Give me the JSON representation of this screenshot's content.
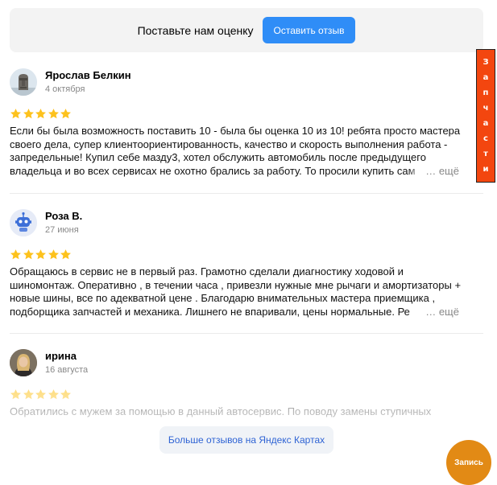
{
  "rating_prompt": {
    "text": "Поставьте нам оценку",
    "button": "Оставить отзыв"
  },
  "colors": {
    "star": "#fdc21d",
    "accent": "#2f8df7",
    "side_tab": "#f3460f",
    "record": "#e28a15"
  },
  "reviews": [
    {
      "author": "Ярослав Белкин",
      "date": "4 октября",
      "rating": 5,
      "avatar_icon": "moai-statue-icon",
      "lines": [
        "Если бы была возможность поставить 10 - была бы оценка 10 из 10! ребята просто мастера",
        "своего дела, супер клиентоориентированность, качество и скорость выполнения работа -",
        "запредельные! Купил себе мазду3, хотел обслужить автомобиль после предыдущего",
        "владельца и во всех сервисах не охотно брались за работу. То просили купить сам"
      ],
      "more": "… ещё"
    },
    {
      "author": "Роза В.",
      "date": "27 июня",
      "rating": 5,
      "avatar_icon": "robot-avatar-icon",
      "lines": [
        "Обращаюсь в сервис не в первый раз. Грамотно сделали диагностику ходовой и",
        "шиномонтаж. Оперативно , в течении часа , привезли нужные мне рычаги и амортизаторы +",
        "новые шины, все по адекватной цене . Благодарю внимательных мастера приемщика ,",
        "подборщика запчастей и механика. Лишнего не впаривали, цены нормальные. Ре"
      ],
      "more": "… ещё"
    },
    {
      "author": "ирина",
      "date": "16 августа",
      "rating": 5,
      "avatar_icon": "user-photo-icon",
      "lines": [
        "Обратились с мужем за помощью в данный автосервис. По поводу замены ступичных"
      ],
      "more": ""
    }
  ],
  "more_reviews_button": "Больше отзывов на Яндекс Картах",
  "side_tab": {
    "chars": [
      "З",
      "а",
      "п",
      "ч",
      "а",
      "с",
      "т",
      "и"
    ]
  },
  "record_button": "Запись"
}
